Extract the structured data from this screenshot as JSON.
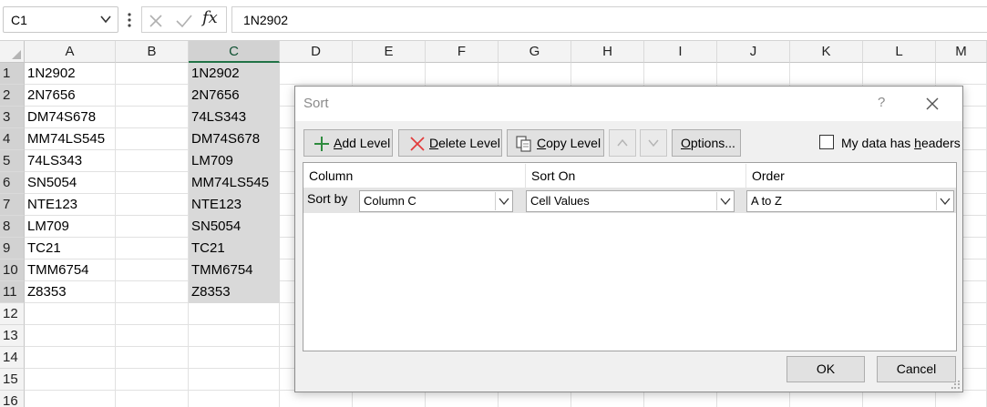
{
  "formula_bar": {
    "name_box": "C1",
    "fx_label": "fx",
    "formula": "1N2902"
  },
  "grid": {
    "columns": [
      "A",
      "B",
      "C",
      "D",
      "E",
      "F",
      "G",
      "H",
      "I",
      "J",
      "K",
      "L",
      "M"
    ],
    "selected_column": "C",
    "rows": [
      "1",
      "2",
      "3",
      "4",
      "5",
      "6",
      "7",
      "8",
      "9",
      "10",
      "11",
      "12",
      "13",
      "14",
      "15",
      "16"
    ],
    "column_a": [
      "1N2902",
      "2N7656",
      "DM74S678",
      "MM74LS545",
      "74LS343",
      "SN5054",
      "NTE123",
      "LM709",
      "TC21",
      "TMM6754",
      "Z8353"
    ],
    "column_c": [
      "1N2902",
      "2N7656",
      "74LS343",
      "DM74S678",
      "LM709",
      "MM74LS545",
      "NTE123",
      "SN5054",
      "TC21",
      "TMM6754",
      "Z8353"
    ]
  },
  "sort_dialog": {
    "title": "Sort",
    "help": "?",
    "toolbar": {
      "add_level": {
        "accel": "A",
        "rest": "dd Level"
      },
      "delete_level": {
        "accel": "D",
        "rest": "elete Level"
      },
      "copy_level": {
        "accel": "C",
        "rest": "opy Level"
      },
      "options": {
        "accel": "O",
        "rest": "ptions..."
      }
    },
    "headers_checkbox": {
      "checked": false,
      "pre": "My data has ",
      "accel": "h",
      "post": "eaders"
    },
    "column_headers": {
      "column": "Column",
      "sort_on": "Sort On",
      "order": "Order"
    },
    "level": {
      "label": "Sort by",
      "column": "Column C",
      "sort_on": "Cell Values",
      "order": "A to Z"
    },
    "ok": "OK",
    "cancel": "Cancel"
  },
  "colors": {
    "add_icon": "#2e8b3e",
    "delete_icon": "#e23b3b",
    "selection": "#d9d9d9",
    "accent": "#217346"
  },
  "icons": [
    "chevron-down-icon",
    "more-vertical-icon",
    "cancel-x-icon",
    "check-icon",
    "function-icon",
    "plus-icon",
    "x-icon",
    "copy-icon",
    "arrow-up-icon",
    "arrow-down-icon",
    "close-icon",
    "resize-grip-icon"
  ]
}
